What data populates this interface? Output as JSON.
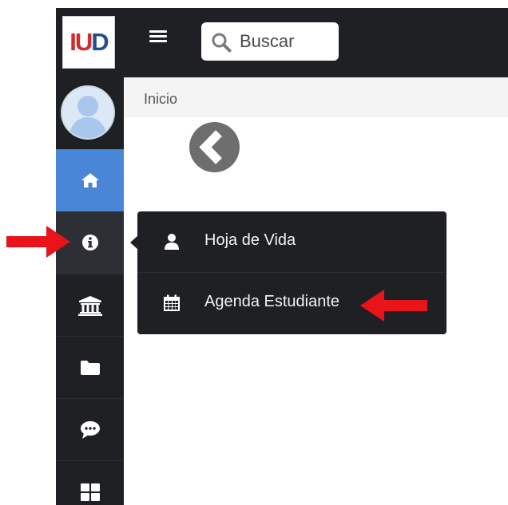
{
  "app": {
    "logo_text": "IUD"
  },
  "header": {
    "search": {
      "placeholder": "Buscar",
      "value": ""
    }
  },
  "breadcrumb": {
    "current": "Inicio"
  },
  "sidebar": {
    "items": [
      {
        "id": "home",
        "icon": "home-icon",
        "active": true
      },
      {
        "id": "info",
        "icon": "info-icon",
        "active": false,
        "open": true
      },
      {
        "id": "institution",
        "icon": "bank-icon"
      },
      {
        "id": "files",
        "icon": "folder-icon"
      },
      {
        "id": "messages",
        "icon": "chat-icon"
      },
      {
        "id": "apps",
        "icon": "grid-icon"
      }
    ]
  },
  "info_menu": {
    "items": [
      {
        "label": "Hoja de Vida",
        "icon": "user-icon"
      },
      {
        "label": "Agenda Estudiante",
        "icon": "calendar-icon"
      }
    ]
  },
  "annotations": {
    "arrow_color": "#e8141a",
    "targets": [
      "info-nav-item",
      "agenda-estudiante-item"
    ]
  },
  "colors": {
    "sidebar_bg": "#1f2024",
    "topbar_bg": "#1f2024",
    "active_item": "#4a86d8",
    "breadcrumb_bg": "#f4f4f4",
    "back_circle": "#6e6e6e"
  }
}
